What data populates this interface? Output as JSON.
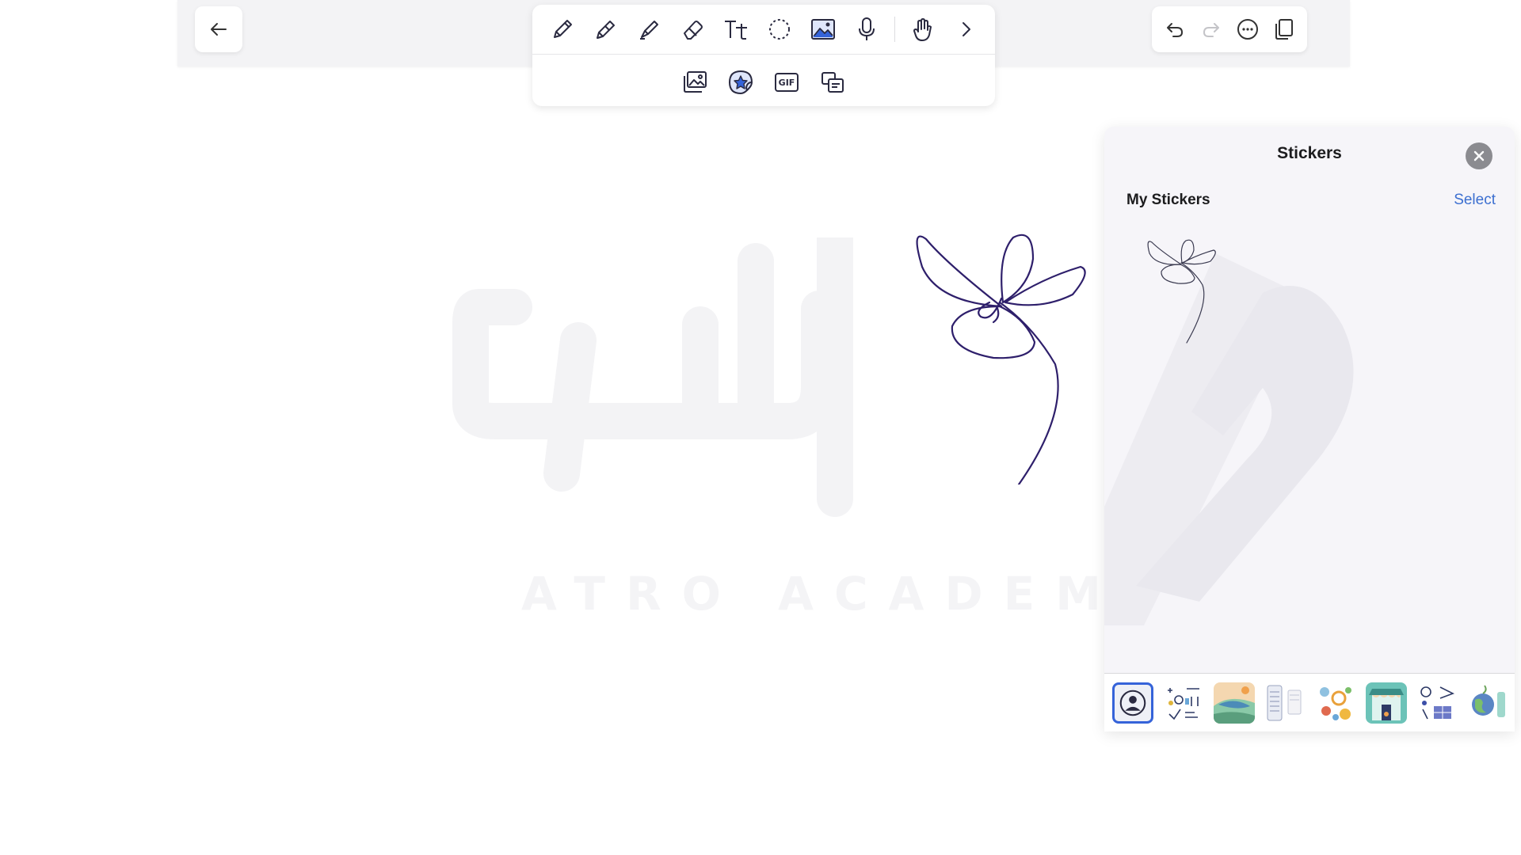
{
  "colors": {
    "accent": "#3563d9",
    "ink": "#2e1f6b",
    "link": "#3c6fd0",
    "close_button": "#8b8b90"
  },
  "watermark": {
    "text": "ATRO ACADEMY"
  },
  "toolbar": {
    "row1": [
      {
        "name": "pen-tool",
        "icon": "pen-icon"
      },
      {
        "name": "pencil-tool",
        "icon": "pencil-icon"
      },
      {
        "name": "highlighter-tool",
        "icon": "highlighter-icon"
      },
      {
        "name": "eraser-tool",
        "icon": "eraser-icon"
      },
      {
        "name": "text-tool",
        "icon": "text-icon"
      },
      {
        "name": "lasso-tool",
        "icon": "lasso-icon"
      },
      {
        "name": "image-tool",
        "icon": "image-icon",
        "active": true
      },
      {
        "name": "microphone-tool",
        "icon": "microphone-icon"
      },
      {
        "name": "hand-tool",
        "icon": "hand-icon"
      },
      {
        "name": "more-tools",
        "icon": "chevron-right-icon"
      }
    ],
    "row2": [
      {
        "name": "photos-tool",
        "icon": "photos-icon"
      },
      {
        "name": "stickers-tool",
        "icon": "sticker-star-icon",
        "active": true
      },
      {
        "name": "gif-tool",
        "icon": "gif-icon",
        "label": "GIF"
      },
      {
        "name": "shapes-tool",
        "icon": "shapes-icon"
      }
    ]
  },
  "header_right": [
    {
      "name": "undo-button",
      "icon": "undo-icon"
    },
    {
      "name": "redo-button",
      "icon": "redo-icon",
      "disabled": true
    },
    {
      "name": "more-options-button",
      "icon": "ellipsis-circle-icon"
    },
    {
      "name": "pages-button",
      "icon": "pages-icon"
    }
  ],
  "stickers_panel": {
    "title": "Stickers",
    "section_title": "My Stickers",
    "select_label": "Select",
    "close_icon": "close-icon",
    "tray": [
      {
        "name": "tray-my-stickers",
        "icon": "user-circle-icon",
        "active": true
      },
      {
        "name": "tray-pack-math"
      },
      {
        "name": "tray-pack-landscape"
      },
      {
        "name": "tray-pack-notes"
      },
      {
        "name": "tray-pack-food"
      },
      {
        "name": "tray-pack-store"
      },
      {
        "name": "tray-pack-stationery"
      },
      {
        "name": "tray-pack-travel"
      }
    ]
  }
}
